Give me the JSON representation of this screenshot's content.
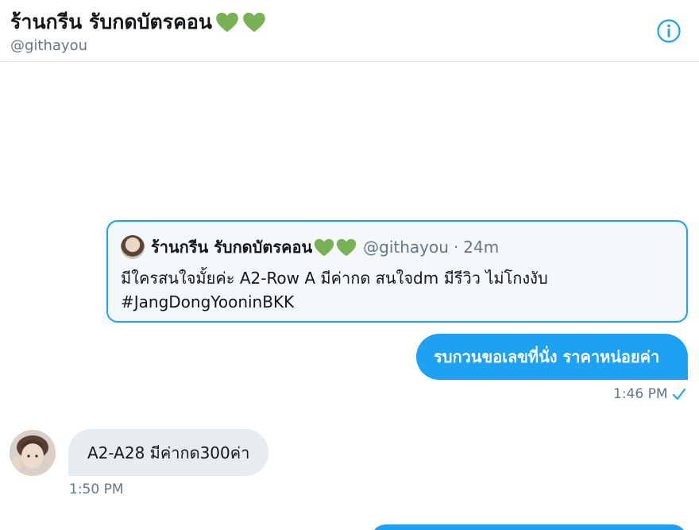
{
  "header": {
    "title": "ร้านกรีน รับกดบัตรคอน",
    "title_emoji": "green-heart-icon",
    "handle": "@githayou",
    "info_icon": "info-icon"
  },
  "quoted_tweet": {
    "name": "ร้านกรีน รับกดบัตรคอน",
    "handle": "@githayou",
    "time": "24m",
    "separator": "·",
    "text_line1": "มีใครสนใจมั้ยค่ะ A2-Row A มีค่ากด สนใจdm มีรีวิว ไม่โกงงับ",
    "text_line2": "#JangDongYooninBKK"
  },
  "messages": {
    "outgoing_1": "รบกวนขอเลขที่นั่ง ราคาหน่อยค่า",
    "outgoing_1_time": "1:46 PM",
    "incoming_1": "A2-A28 มีค่ากด300ค่า",
    "incoming_1_time": "1:50 PM"
  },
  "colors": {
    "accent": "#1da1f2",
    "heart": "#77b255",
    "secondary_text": "#657786",
    "incoming_bubble": "#e6ecf0"
  }
}
